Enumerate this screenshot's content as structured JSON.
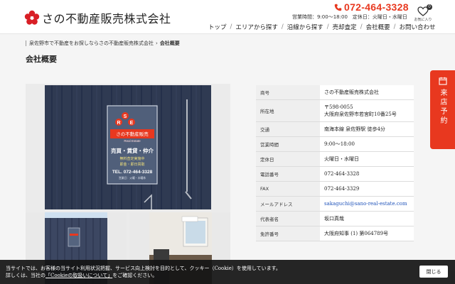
{
  "header": {
    "logo_text": "さの不動産販売株式会社",
    "phone": "072-464-3328",
    "hours": "営業時間：9:00〜18:00　定休日：火曜日・水曜日",
    "favorites_label": "お気に入り",
    "favorites_count": "0",
    "nav": [
      {
        "label": "トップ"
      },
      {
        "label": "エリアから探す"
      },
      {
        "label": "沿線から探す"
      },
      {
        "label": "売却査定"
      },
      {
        "label": "会社概要"
      },
      {
        "label": "お問い合わせ"
      }
    ]
  },
  "breadcrumb": {
    "parent": "泉佐野市で不動産をお探しならさの不動産販売株式会社",
    "separator": "›",
    "current": "会社概要"
  },
  "page_title": "会社概要",
  "sign": {
    "logo_letters": [
      "S",
      "R",
      "E"
    ],
    "company": "さの不動産販売",
    "english": "Real Estate",
    "services": "売買・賃貸・仲介",
    "line1": "無料査定実施中",
    "line2": "即金・即日買取",
    "tel": "TEL. 072-464-3328",
    "note": "営業日：火曜・水曜休"
  },
  "company_info": [
    {
      "label": "商号",
      "value": [
        "さの不動産販売株式会社"
      ]
    },
    {
      "label": "所在地",
      "value": [
        "〒598-0055",
        "大阪府泉佐野市若宮町10番25号"
      ]
    },
    {
      "label": "交通",
      "value": [
        "南海本線 泉佐野駅 徒歩4分"
      ]
    },
    {
      "label": "営業時間",
      "value": [
        "9:00〜18:00"
      ]
    },
    {
      "label": "定休日",
      "value": [
        "火曜日・水曜日"
      ]
    },
    {
      "label": "電話番号",
      "value": [
        "072-464-3328"
      ]
    },
    {
      "label": "FAX",
      "value": [
        "072-464-3329"
      ]
    },
    {
      "label": "メールアドレス",
      "value": [
        "sakaguchi@sano-real-estate.com"
      ]
    },
    {
      "label": "代表者名",
      "value": [
        "坂口真哉"
      ]
    },
    {
      "label": "免許番号",
      "value": [
        "大阪府知事 (1) 第064789号"
      ]
    }
  ],
  "side_tab": {
    "label": "来店予約"
  },
  "cookie": {
    "line1": "当サイトでは、お客様の当サイト利用状況把握、サービス向上検討を目的として、クッキー（Cookie）を使用しています。",
    "line2_before": "詳しくは、当社の",
    "line2_link": "「Cookieの取扱いについて」",
    "line2_after": "をご確認ください。",
    "close_label": "閉じる"
  },
  "colors": {
    "accent": "#e8381f",
    "nav_text": "#222222",
    "page_bg": "#f5f5f5",
    "cookie_bg": "#141414"
  }
}
